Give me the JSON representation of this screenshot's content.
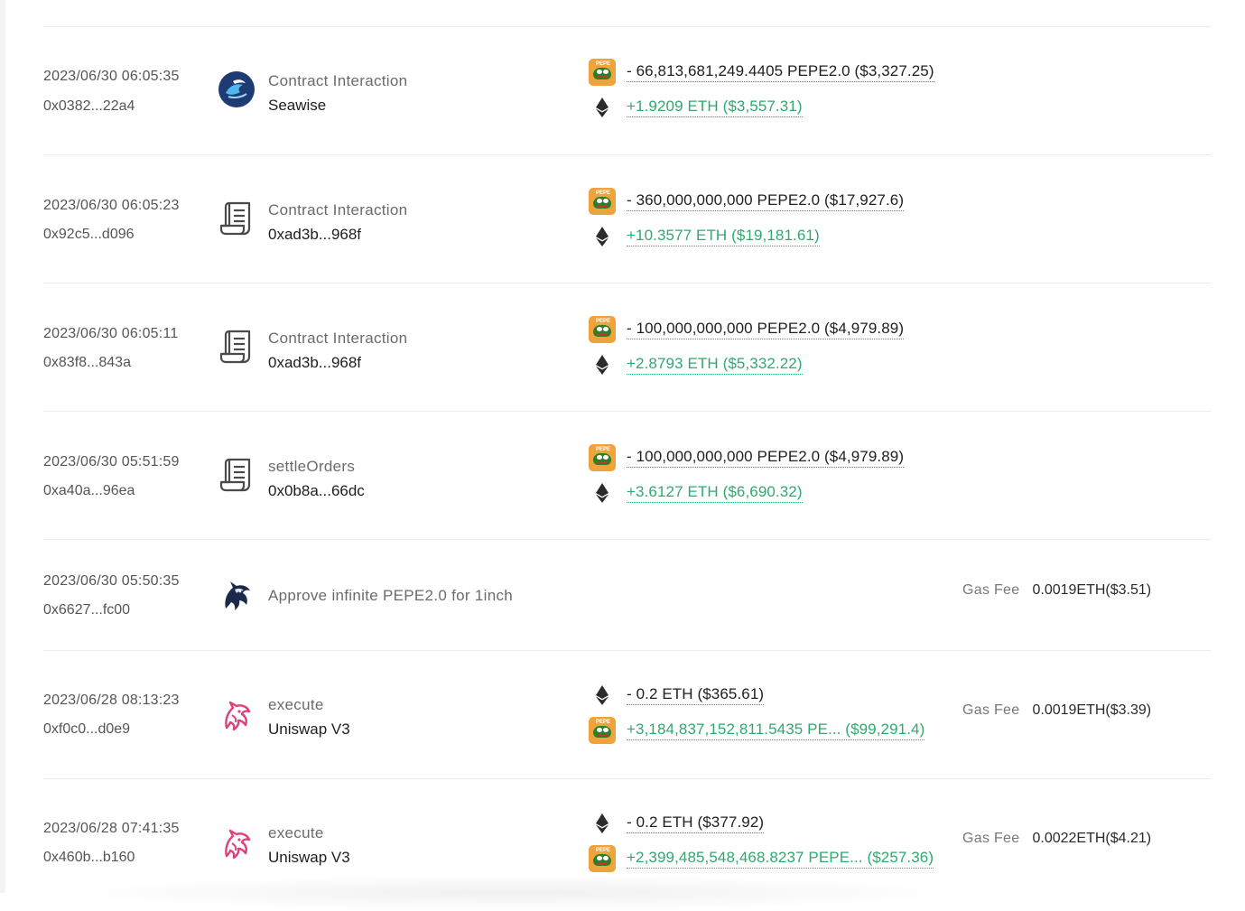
{
  "transactions": [
    {
      "time": "2023/06/30 06:05:35",
      "hash": "0x0382...22a4",
      "op_icon": "seawise-logo",
      "op_title": "Contract Interaction",
      "op_sub": "Seawise",
      "amounts": [
        {
          "token_icon": "pepe-icon",
          "text": "- 66,813,681,249.4405 PEPE2.0 ($3,327.25)",
          "sign": "neg"
        },
        {
          "token_icon": "eth-icon",
          "text": "+1.9209 ETH ($3,557.31)",
          "sign": "pos"
        }
      ]
    },
    {
      "time": "2023/06/30 06:05:23",
      "hash": "0x92c5...d096",
      "op_icon": "contract-scroll-icon",
      "op_title": "Contract Interaction",
      "op_sub": "0xad3b...968f",
      "amounts": [
        {
          "token_icon": "pepe-icon",
          "text": "- 360,000,000,000 PEPE2.0 ($17,927.6)",
          "sign": "neg"
        },
        {
          "token_icon": "eth-icon",
          "text": "+10.3577 ETH ($19,181.61)",
          "sign": "pos"
        }
      ]
    },
    {
      "time": "2023/06/30 06:05:11",
      "hash": "0x83f8...843a",
      "op_icon": "contract-scroll-icon",
      "op_title": "Contract Interaction",
      "op_sub": "0xad3b...968f",
      "amounts": [
        {
          "token_icon": "pepe-icon",
          "text": "- 100,000,000,000 PEPE2.0 ($4,979.89)",
          "sign": "neg"
        },
        {
          "token_icon": "eth-icon",
          "text": "+2.8793 ETH ($5,332.22)",
          "sign": "pos"
        }
      ]
    },
    {
      "time": "2023/06/30 05:51:59",
      "hash": "0xa40a...96ea",
      "op_icon": "contract-scroll-icon",
      "op_title": "settleOrders",
      "op_sub": "0x0b8a...66dc",
      "amounts": [
        {
          "token_icon": "pepe-icon",
          "text": "- 100,000,000,000 PEPE2.0 ($4,979.89)",
          "sign": "neg"
        },
        {
          "token_icon": "eth-icon",
          "text": "+3.6127 ETH ($6,690.32)",
          "sign": "pos"
        }
      ]
    },
    {
      "time": "2023/06/30 05:50:35",
      "hash": "0x6627...fc00",
      "op_icon": "1inch-unicorn-icon",
      "op_title": "Approve infinite PEPE2.0 for 1inch",
      "op_sub": "",
      "amounts": [],
      "gas_label": "Gas Fee",
      "gas_value": "0.0019ETH($3.51)"
    },
    {
      "time": "2023/06/28 08:13:23",
      "hash": "0xf0c0...d0e9",
      "op_icon": "uniswap-unicorn-icon",
      "op_title": "execute",
      "op_sub": "Uniswap V3",
      "amounts": [
        {
          "token_icon": "eth-icon",
          "text": "- 0.2 ETH ($365.61)",
          "sign": "neg"
        },
        {
          "token_icon": "pepe-icon",
          "text": "+3,184,837,152,811.5435 PE...  ($99,291.4)",
          "sign": "pos"
        }
      ],
      "gas_label": "Gas Fee",
      "gas_value": "0.0019ETH($3.39)"
    },
    {
      "time": "2023/06/28 07:41:35",
      "hash": "0x460b...b160",
      "op_icon": "uniswap-unicorn-icon",
      "op_title": "execute",
      "op_sub": "Uniswap V3",
      "amounts": [
        {
          "token_icon": "eth-icon",
          "text": "- 0.2 ETH ($377.92)",
          "sign": "neg"
        },
        {
          "token_icon": "pepe-icon",
          "text": "+2,399,485,548,468.8237 PEPE...  ($257.36)",
          "sign": "pos"
        }
      ],
      "gas_label": "Gas Fee",
      "gas_value": "0.0022ETH($4.21)"
    }
  ],
  "colors": {
    "positive": "#2faa6e",
    "pepe_bg": "#f0a23b",
    "uniswap_pink": "#e0407a"
  }
}
